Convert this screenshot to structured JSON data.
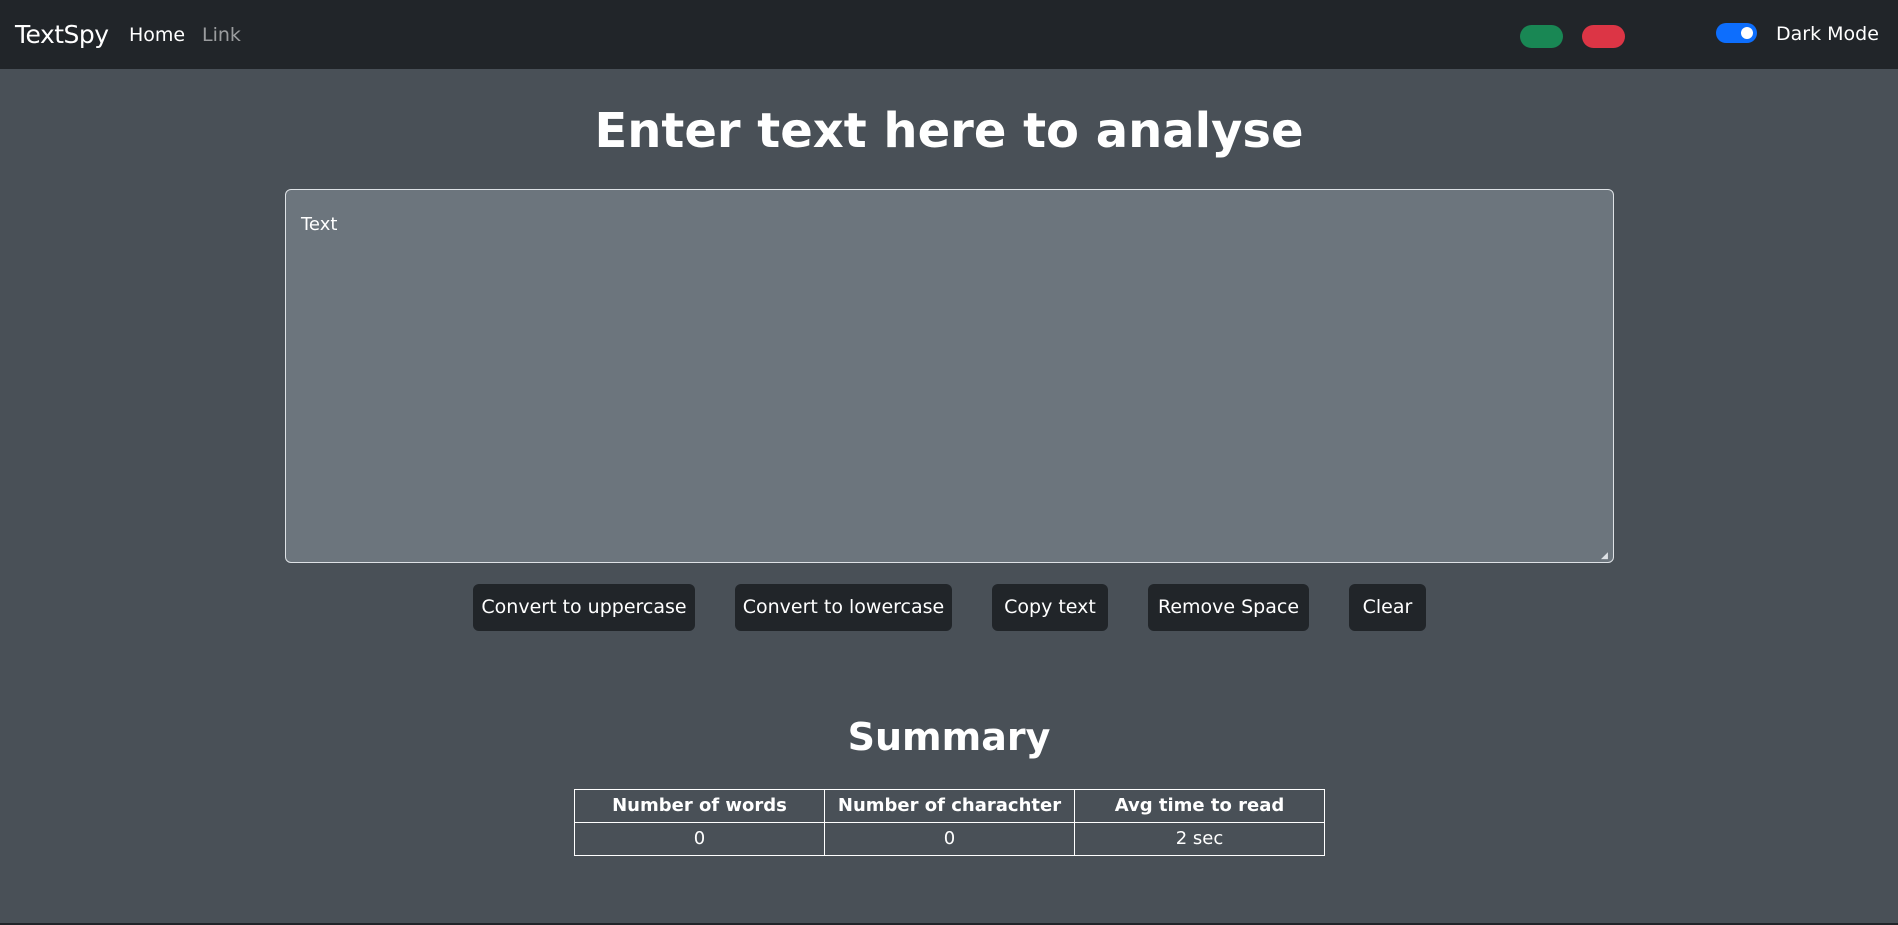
{
  "navbar": {
    "brand": "TextSpy",
    "links": [
      "Home",
      "Link"
    ],
    "theme_colors": [
      "#198754",
      "#dc3545"
    ],
    "dark_mode_label": "Dark Mode",
    "dark_mode_on": true
  },
  "main": {
    "heading": "Enter text here to analyse",
    "textarea_placeholder": "Text",
    "buttons": [
      "Convert to uppercase",
      "Convert to lowercase",
      "Copy text",
      "Remove Space",
      "Clear"
    ]
  },
  "summary": {
    "title": "Summary",
    "headers": [
      "Number of words",
      "Number of charachter",
      "Avg time to read"
    ],
    "values": [
      "0",
      "0",
      "2 sec"
    ]
  },
  "colors": {
    "background": "#495057",
    "navbar": "#212529",
    "textarea": "#6c757d",
    "accent": "#0d6efd"
  }
}
